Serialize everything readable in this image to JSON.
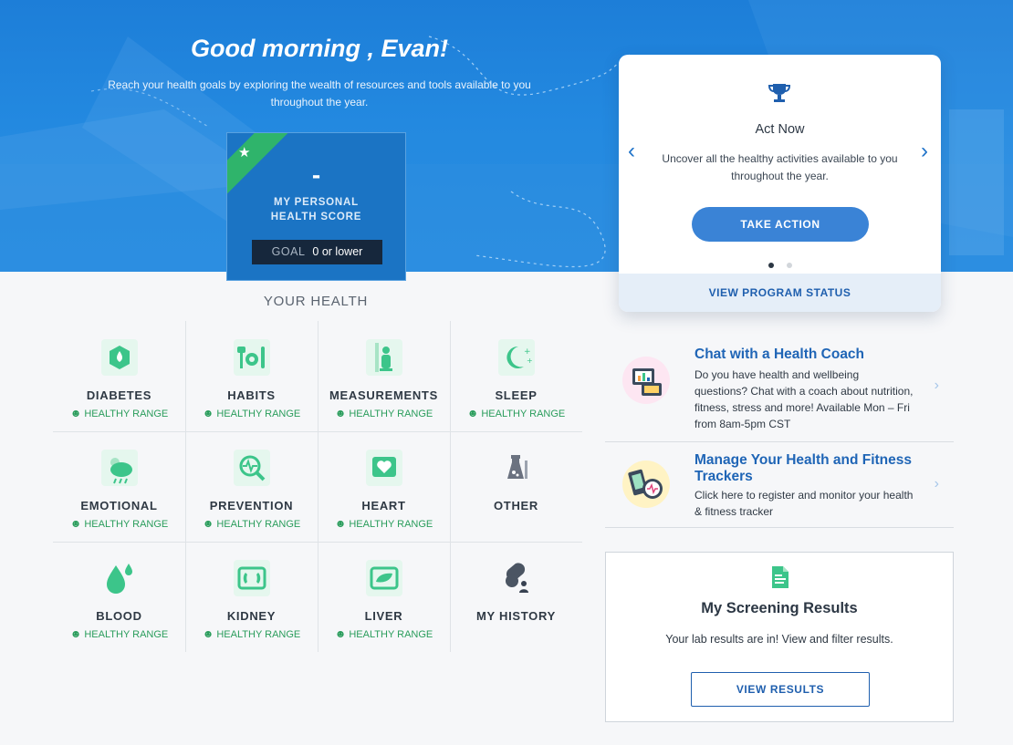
{
  "hero": {
    "greeting": "Good morning , Evan!",
    "subtitle": "Reach your health goals by exploring the wealth of resources and tools available to you throughout the year."
  },
  "score": {
    "value": "-",
    "label_line1": "MY PERSONAL",
    "label_line2": "HEALTH SCORE",
    "goal_key": "GOAL",
    "goal_value": "0 or lower"
  },
  "act_card": {
    "title": "Act Now",
    "description": "Uncover all the healthy activities available to you throughout the year.",
    "button_label": "TAKE ACTION",
    "footer_link": "VIEW PROGRAM STATUS",
    "slide_count": 2,
    "active_slide": 1
  },
  "health": {
    "heading": "YOUR HEALTH",
    "range_label": "HEALTHY RANGE",
    "items": [
      {
        "name": "DIABETES",
        "status": "HEALTHY RANGE",
        "icon": "diabetes-icon"
      },
      {
        "name": "HABITS",
        "status": "HEALTHY RANGE",
        "icon": "habits-icon"
      },
      {
        "name": "MEASUREMENTS",
        "status": "HEALTHY RANGE",
        "icon": "measurements-icon"
      },
      {
        "name": "SLEEP",
        "status": "HEALTHY RANGE",
        "icon": "sleep-icon"
      },
      {
        "name": "EMOTIONAL",
        "status": "HEALTHY RANGE",
        "icon": "emotional-icon"
      },
      {
        "name": "PREVENTION",
        "status": "HEALTHY RANGE",
        "icon": "prevention-icon"
      },
      {
        "name": "HEART",
        "status": "HEALTHY RANGE",
        "icon": "heart-icon"
      },
      {
        "name": "OTHER",
        "status": "",
        "icon": "other-icon"
      },
      {
        "name": "BLOOD",
        "status": "HEALTHY RANGE",
        "icon": "blood-icon"
      },
      {
        "name": "KIDNEY",
        "status": "HEALTHY RANGE",
        "icon": "kidney-icon"
      },
      {
        "name": "LIVER",
        "status": "HEALTHY RANGE",
        "icon": "liver-icon"
      },
      {
        "name": "MY HISTORY",
        "status": "",
        "icon": "history-icon"
      }
    ]
  },
  "links": {
    "coach": {
      "title": "Chat with a Health Coach",
      "description": "Do you have health and wellbeing questions? Chat with a coach about nutrition, fitness, stress and more! Available Mon – Fri from 8am-5pm CST"
    },
    "trackers": {
      "title": "Manage Your Health and Fitness Trackers",
      "description": "Click here to register and monitor your health & fitness tracker"
    }
  },
  "screening": {
    "title": "My Screening Results",
    "description": "Your lab results are in! View and filter results.",
    "button_label": "VIEW RESULTS"
  },
  "colors": {
    "hero_blue": "#2389e0",
    "healthy_green": "#2a9d5c",
    "link_blue": "#1f65b6",
    "button_blue": "#3a83d6",
    "icon_mint": "#b8ecd4"
  }
}
